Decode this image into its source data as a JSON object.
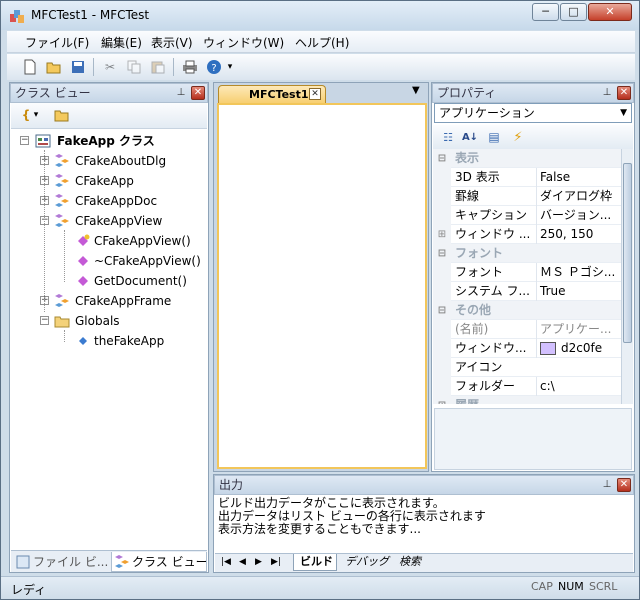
{
  "window": {
    "title": "MFCTest1 - MFCTest"
  },
  "menu": [
    "ファイル(F)",
    "編集(E)",
    "表示(V)",
    "ウィンドウ(W)",
    "ヘルプ(H)"
  ],
  "class_view": {
    "title": "クラス ビュー",
    "root": "FakeApp クラス",
    "items": [
      "CFakeAboutDlg",
      "CFakeApp",
      "CFakeAppDoc",
      "CFakeAppView",
      "CFakeAppView()",
      "~CFakeAppView()",
      "GetDocument()",
      "CFakeAppFrame",
      "Globals",
      "theFakeApp"
    ],
    "tabs": [
      "ファイル ビ...",
      "クラス ビュー"
    ]
  },
  "document": {
    "tab": "MFCTest1"
  },
  "properties": {
    "title": "プロパティ",
    "selected": "アプリケーション",
    "categories": [
      "表示",
      "フォント",
      "その他",
      "履歴"
    ],
    "rows": [
      {
        "k": "3D 表示",
        "v": "False"
      },
      {
        "k": "罫線",
        "v": "ダイアログ枠"
      },
      {
        "k": "キャプション",
        "v": "バージョン..."
      },
      {
        "k": "ウィンドウ ...",
        "v": "250, 150"
      },
      {
        "k": "フォント",
        "v": "ＭＳ Ｐゴシ..."
      },
      {
        "k": "システム フ...",
        "v": "True"
      },
      {
        "k": "(名前)",
        "v": "アプリケー..."
      },
      {
        "k": "ウィンドウ...",
        "v": "d2c0fe"
      },
      {
        "k": "アイコン",
        "v": ""
      },
      {
        "k": "フォルダー",
        "v": "c:\\"
      }
    ],
    "swatch": "#d2c0fe"
  },
  "output": {
    "title": "出力",
    "lines": [
      "ビルド出力データがここに表示されます。",
      "出力データはリスト ビューの各行に表示されます",
      "表示方法を変更することもできます..."
    ],
    "tabs": [
      "ビルド",
      "デバッグ",
      "検索"
    ]
  },
  "status": {
    "ready": "レディ",
    "indicators": [
      "CAP",
      "NUM",
      "SCRL"
    ]
  }
}
